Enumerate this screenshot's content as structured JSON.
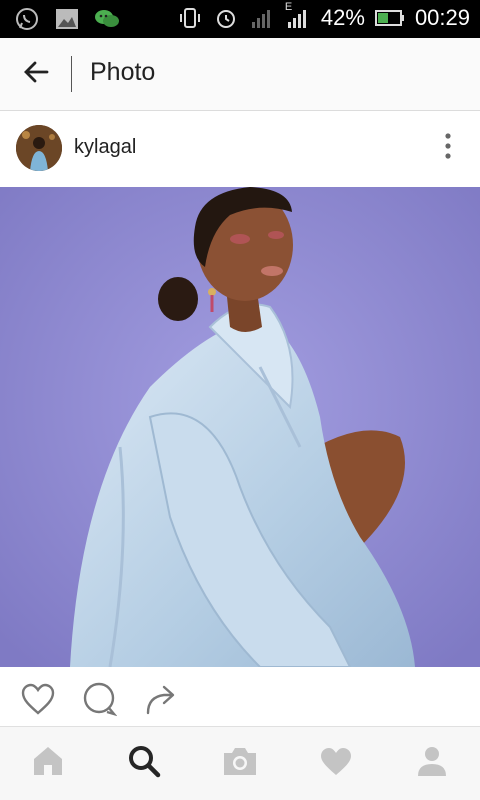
{
  "status_bar": {
    "battery_percent": "42%",
    "time": "00:29",
    "network_type": "E",
    "icons": [
      "whatsapp-icon",
      "gallery-icon",
      "wechat-icon",
      "vibrate-icon",
      "alarm-icon",
      "signal-icon",
      "signal-icon",
      "battery-icon"
    ]
  },
  "app_bar": {
    "title": "Photo",
    "back_icon": "arrow-left-icon"
  },
  "post": {
    "username": "kylagal",
    "menu_icon": "more-vertical-icon",
    "photo_icon": "photo-image"
  },
  "actions": [
    "heart-icon",
    "comment-icon",
    "share-icon"
  ],
  "bottom_nav": [
    "home-icon",
    "search-icon",
    "camera-icon",
    "activity-heart-icon",
    "profile-icon"
  ],
  "colors": {
    "status_bar_bg": "#000000",
    "app_bar_bg": "#fafafa",
    "photo_background": "#8d88d0",
    "battery_fill": "#4caf50",
    "icon_inactive": "#c4c4c4",
    "icon_active": "#262626"
  }
}
